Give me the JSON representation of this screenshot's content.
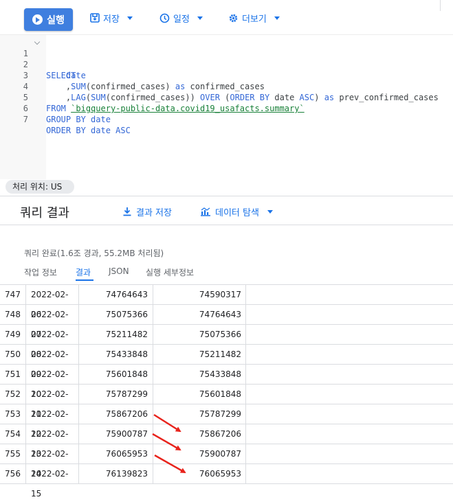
{
  "toolbar": {
    "run_label": "실행",
    "save_label": "저장",
    "schedule_label": "일정",
    "more_label": "더보기"
  },
  "editor": {
    "line_numbers": [
      "1",
      "2",
      "3",
      "4",
      "5",
      "6",
      "7"
    ],
    "lines": [
      {
        "kw": "SELECT"
      },
      {
        "indent": "    ",
        "text": "date"
      },
      {
        "indent": "    ",
        "p1": ",",
        "fn": "SUM",
        "p2": "(confirmed_cases) ",
        "kw": "as",
        "p3": " confirmed_cases"
      },
      {
        "indent": "    ",
        "p1": ",",
        "fn1": "LAG",
        "p2": "(",
        "fn2": "SUM",
        "p3": "(confirmed_cases)) ",
        "kw1": "OVER",
        "p4": " (",
        "kw2": "ORDER BY",
        "p5": " date ",
        "kw3": "ASC",
        "p6": ") ",
        "kw4": "as",
        "p7": " prev_confirmed_cases"
      },
      {
        "kw": "FROM",
        "tbl": "`bigquery-public-data.covid19_usafacts.summary`"
      },
      {
        "kw": "GROUP BY",
        "text": "date"
      },
      {
        "kw": "ORDER BY",
        "text": "date",
        "kw2": "ASC"
      }
    ]
  },
  "location_chip": "처리 위치: US",
  "results": {
    "title": "쿼리 결과",
    "save_results": "결과 저장",
    "explore_data": "데이터 탐색",
    "status": "쿼리 완료(1.6조 경과, 55.2MB 처리됨)",
    "tabs": [
      "작업 정보",
      "결과",
      "JSON",
      "실행 세부정보"
    ],
    "active_tab": "결과",
    "rows": [
      [
        "747",
        "2022-02-06",
        "74764643",
        "74590317"
      ],
      [
        "748",
        "2022-02-07",
        "75075366",
        "74764643"
      ],
      [
        "749",
        "2022-02-08",
        "75211482",
        "75075366"
      ],
      [
        "750",
        "2022-02-09",
        "75433848",
        "75211482"
      ],
      [
        "751",
        "2022-02-10",
        "75601848",
        "75433848"
      ],
      [
        "752",
        "2022-02-11",
        "75787299",
        "75601848"
      ],
      [
        "753",
        "2022-02-12",
        "75867206",
        "75787299"
      ],
      [
        "754",
        "2022-02-13",
        "75900787",
        "75867206"
      ],
      [
        "755",
        "2022-02-14",
        "76065953",
        "75900787"
      ],
      [
        "756",
        "2022-02-15",
        "76139823",
        "76065953"
      ]
    ]
  },
  "annotation": {
    "arrow_color": "#e8231c",
    "arrow_count": 3
  },
  "colors": {
    "accent": "#1a73e8",
    "run_button": "#3f7fdf",
    "keyword": "#3367d6",
    "table_ref": "#188038"
  }
}
